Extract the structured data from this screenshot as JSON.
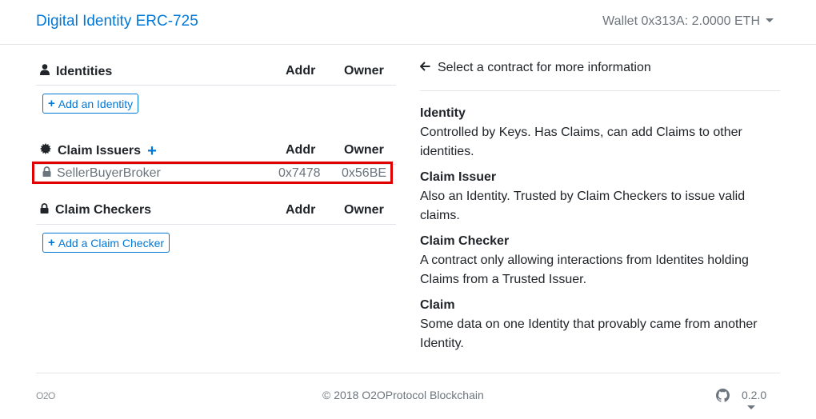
{
  "navbar": {
    "brand": "Digital Identity ERC-725",
    "wallet": "Wallet 0x313A: 2.0000 ETH"
  },
  "identities": {
    "title": "Identities",
    "col_addr": "Addr",
    "col_owner": "Owner",
    "add_button": "Add an Identity"
  },
  "claim_issuers": {
    "title": "Claim Issuers",
    "col_addr": "Addr",
    "col_owner": "Owner",
    "items": [
      {
        "name": "SellerBuyerBroker",
        "addr": "0x7478",
        "owner": "0x56BE"
      }
    ]
  },
  "claim_checkers": {
    "title": "Claim Checkers",
    "col_addr": "Addr",
    "col_owner": "Owner",
    "add_button": "Add a Claim Checker"
  },
  "info": {
    "select_message": "Select a contract for more information",
    "items": [
      {
        "title": "Identity",
        "desc": "Controlled by Keys. Has Claims, can add Claims to other identities."
      },
      {
        "title": "Claim Issuer",
        "desc": "Also an Identity. Trusted by Claim Checkers to issue valid claims."
      },
      {
        "title": "Claim Checker",
        "desc": "A contract only allowing interactions from Identites holding Claims from a Trusted Issuer."
      },
      {
        "title": "Claim",
        "desc": "Some data on one Identity that provably came from another Identity."
      }
    ]
  },
  "footer": {
    "logo": "O2O",
    "copyright": "© 2018  O2OProtocol Blockchain",
    "version": "0.2.0"
  },
  "colors": {
    "accent": "#0078d7",
    "highlight_border": "#e00000",
    "muted": "#6c757d"
  },
  "icons": [
    "user-icon",
    "certificate-icon",
    "lock-icon",
    "plus-icon",
    "arrow-left-icon",
    "github-icon",
    "caret-down-icon"
  ]
}
